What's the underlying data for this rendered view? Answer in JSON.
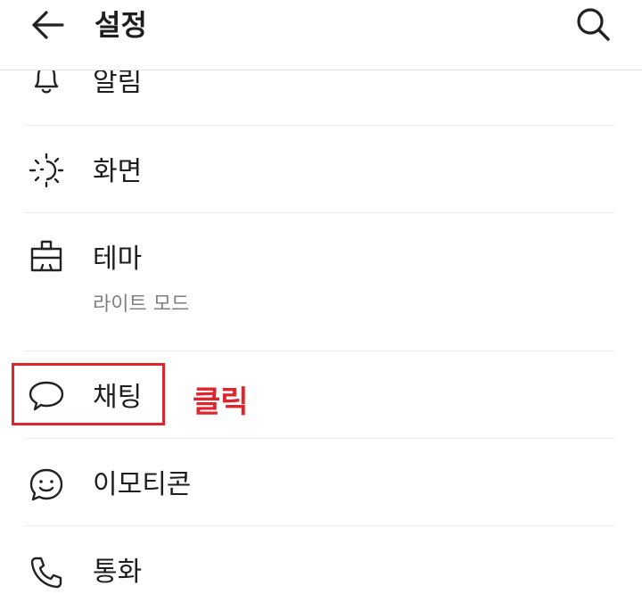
{
  "header": {
    "title": "설정",
    "back_icon": "arrow-left-icon",
    "search_icon": "search-icon"
  },
  "settings": {
    "items": [
      {
        "label": "알림",
        "icon": "bell-icon"
      },
      {
        "label": "화면",
        "icon": "brightness-icon"
      },
      {
        "label": "테마",
        "icon": "paint-brush-icon",
        "subtitle": "라이트 모드"
      },
      {
        "label": "채팅",
        "icon": "speech-bubble-icon"
      },
      {
        "label": "이모티콘",
        "icon": "smiley-bubble-icon"
      },
      {
        "label": "통화",
        "icon": "phone-icon"
      }
    ]
  },
  "annotation": {
    "click_label": "클릭",
    "color": "#e0242b"
  }
}
